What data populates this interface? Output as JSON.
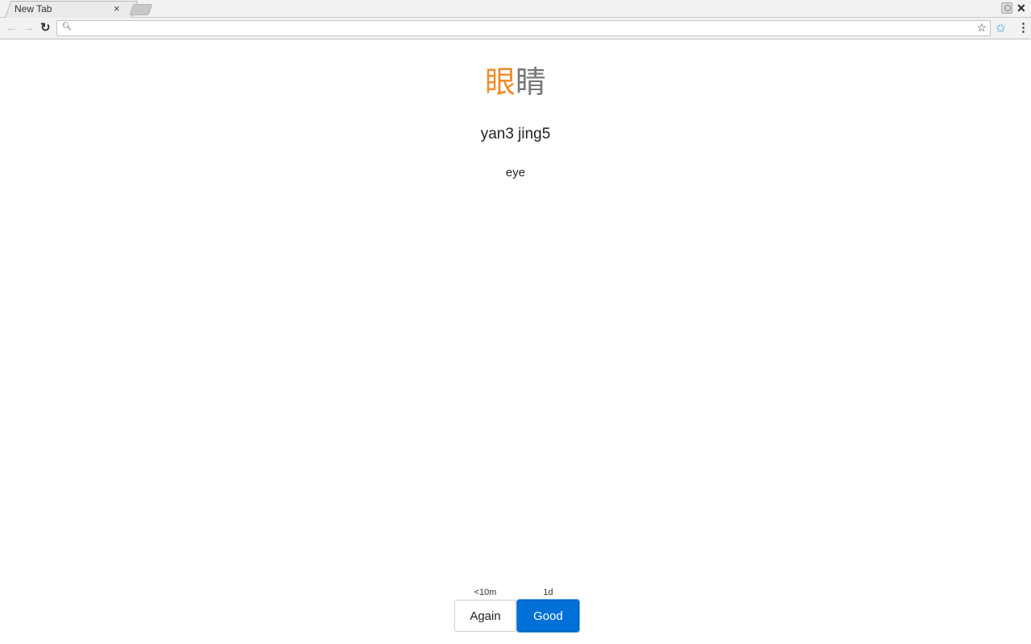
{
  "browser": {
    "tab_title": "New Tab",
    "tab_close_icon": "×",
    "close_window_icon": "✕",
    "address_bar": {
      "value": "",
      "placeholder": ""
    },
    "icons": {
      "back": "←",
      "forward": "→",
      "reload": "↻",
      "search": "🔍",
      "bookmark_star": "☆",
      "extension": "✩",
      "menu": "⋮"
    }
  },
  "card": {
    "hanzi": [
      {
        "char": "眼",
        "tone_color": "#f28c28"
      },
      {
        "char": "睛",
        "tone_color": "#777777"
      }
    ],
    "pinyin": "yan3 jing5",
    "meaning": "eye"
  },
  "answers": [
    {
      "label": "Again",
      "interval": "<10m"
    },
    {
      "label": "Good",
      "interval": "1d",
      "accent": "#0070d9"
    }
  ]
}
